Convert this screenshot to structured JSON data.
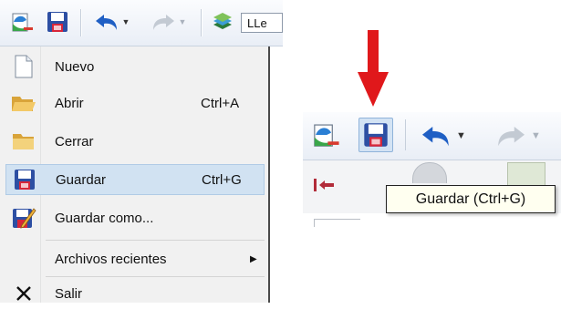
{
  "toolbar": {
    "combo_text": "LLe",
    "icons": [
      "new-document-icon",
      "save-icon",
      "undo-icon",
      "redo-icon",
      "layers-icon"
    ]
  },
  "menu": {
    "items": [
      {
        "label": "Nuevo",
        "shortcut": "",
        "icon": "new-document-icon"
      },
      {
        "label": "Abrir",
        "shortcut": "Ctrl+A",
        "icon": "open-folder-icon"
      },
      {
        "label": "Cerrar",
        "shortcut": "",
        "icon": "close-folder-icon"
      },
      {
        "label": "Guardar",
        "shortcut": "Ctrl+G",
        "icon": "save-icon",
        "highlighted": true
      },
      {
        "label": "Guardar como...",
        "shortcut": "",
        "icon": "save-as-icon"
      },
      {
        "label": "Archivos recientes",
        "shortcut": "",
        "icon": "",
        "submenu": true
      },
      {
        "label": "Salir",
        "shortcut": "",
        "icon": "exit-icon"
      }
    ]
  },
  "tooltip": {
    "text": "Guardar (Ctrl+G)"
  },
  "colors": {
    "highlight": "#d1e2f2",
    "arrow": "#e0181b",
    "save_blue": "#1f4fa0",
    "tooltip_bg": "#fffff0"
  }
}
